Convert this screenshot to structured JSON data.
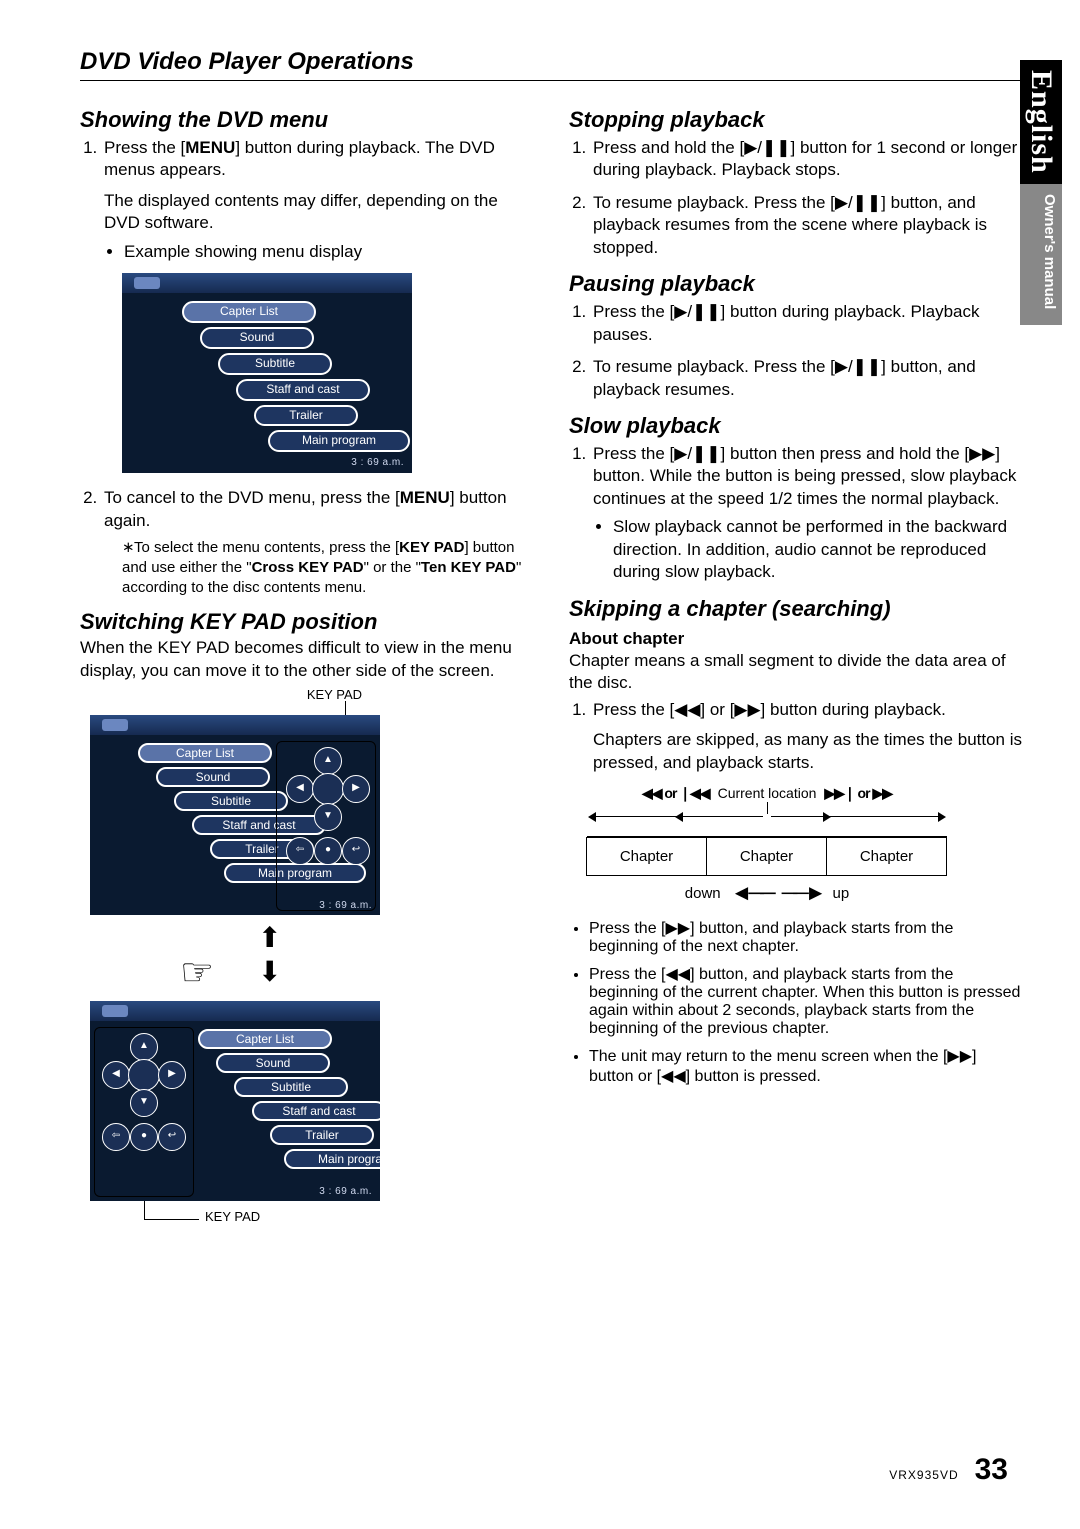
{
  "side": {
    "language": "English",
    "doc": "Owner's manual"
  },
  "header": {
    "title": "DVD Video Player Operations"
  },
  "left": {
    "s1_title": "Showing the DVD menu",
    "s1_li1a": "Press the [",
    "s1_li1b": "MENU",
    "s1_li1c": "] button during playback. The DVD menus appears.",
    "s1_p1": "The displayed contents may differ, depending on the DVD software.",
    "s1_b1": "Example showing menu display",
    "menu": {
      "items": [
        "Capter List",
        "Sound",
        "Subtitle",
        "Staff and cast",
        "Trailer",
        "Main program"
      ],
      "footer": "3 : 69 a.m."
    },
    "s1_li2a": "To cancel to  the DVD menu, press the [",
    "s1_li2b": "MENU",
    "s1_li2c": "] button again.",
    "s1_note_a": "To select the menu contents, press the [",
    "s1_note_b": "KEY PAD",
    "s1_note_c": "] button and use either the \"",
    "s1_note_d": "Cross KEY PAD",
    "s1_note_e": "\" or the \"",
    "s1_note_f": "Ten KEY PAD",
    "s1_note_g": "\" according to the disc contents menu.",
    "s2_title": "Switching KEY PAD position",
    "s2_body": "When the KEY PAD becomes difficult to view in the menu display, you can move it to the other side of the screen.",
    "keypad_label": "KEY PAD"
  },
  "right": {
    "s3_title": "Stopping playback",
    "s3_li1": "Press and hold the [▶/❚❚] button for 1 second or longer during playback. Playback stops.",
    "s3_li2": "To resume playback. Press the [▶/❚❚] button, and playback resumes from the scene where playback is stopped.",
    "s4_title": "Pausing playback",
    "s4_li1": "Press the [▶/❚❚] button during playback. Playback pauses.",
    "s4_li2": "To resume playback. Press the [▶/❚❚] button, and playback resumes.",
    "s5_title": "Slow playback",
    "s5_li1": "Press the [▶/❚❚] button then press and hold the [▶▶] button. While the button is being pressed, slow playback continues at the speed 1/2 times the normal playback.",
    "s5_b1": "Slow playback cannot be performed in the backward direction. In addition, audio cannot be reproduced during slow playback.",
    "s6_title": "Skipping a chapter (searching)",
    "s6_sub": "About chapter",
    "s6_body": "Chapter means a small segment to divide the data area of the disc.",
    "s6_li1": "Press the [◀◀] or [▶▶] button during playback.",
    "s6_li1b": "Chapters are skipped, as many as the times the button is pressed, and playback starts.",
    "diagram": {
      "left_sym": "◀◀ or ❘◀◀",
      "center": "Current location",
      "right_sym": "▶▶❘ or ▶▶",
      "chapter": "Chapter",
      "down": "down",
      "up": "up"
    },
    "s6_b1": "Press the [▶▶] button, and playback starts from the beginning of the next chapter.",
    "s6_b2": "Press the [◀◀] button, and playback starts from the beginning of the current chapter. When this button is pressed again within about 2 seconds, playback starts from the beginning of the previous chapter.",
    "s6_b3": "The unit may return to the menu screen when the [▶▶] button or [◀◀] button is pressed."
  },
  "footer": {
    "model": "VRX935VD",
    "page": "33"
  }
}
